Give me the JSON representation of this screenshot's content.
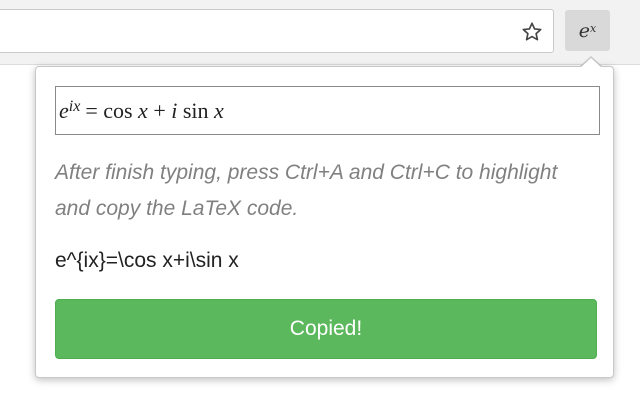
{
  "toolbar": {
    "star_icon": "star-outline-icon",
    "extension_button": {
      "base": "e",
      "exponent": "x"
    }
  },
  "popup": {
    "math_field": {
      "base": "e",
      "exponent": "ix",
      "rest": "= cos x + i sin x"
    },
    "instructions": "After finish typing, press Ctrl+A and Ctrl+C to highlight and copy the LaTeX code.",
    "latex_output": "e^{ix}=\\cos x+i\\sin x",
    "copy_button_label": "Copied!",
    "colors": {
      "button": "#5cb85c",
      "instructions": "#808080"
    }
  }
}
